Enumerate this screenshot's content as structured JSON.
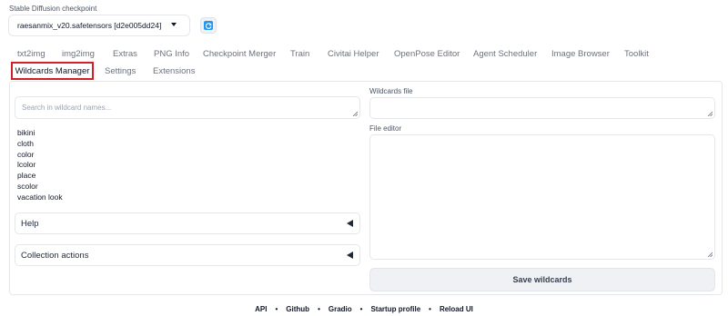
{
  "checkpoint": {
    "label": "Stable Diffusion checkpoint",
    "value": "raesanmix_v20.safetensors [d2e005dd24]"
  },
  "tabs": {
    "row1": [
      "txt2img",
      "img2img",
      "Extras",
      "PNG Info",
      "Checkpoint Merger",
      "Train",
      "Civitai Helper",
      "OpenPose Editor",
      "Agent Scheduler",
      "Image Browser",
      "Toolkit"
    ],
    "row2": [
      "Wildcards Manager",
      "Settings",
      "Extensions"
    ],
    "active": "Wildcards Manager"
  },
  "wildcards": {
    "search_placeholder": "Search in wildcard names...",
    "items": [
      "bikini",
      "cloth",
      "color",
      "lcolor",
      "place",
      "scolor",
      "vacation look"
    ],
    "help_label": "Help",
    "collection_label": "Collection actions",
    "file_label": "Wildcards file",
    "editor_label": "File editor",
    "save_label": "Save wildcards"
  },
  "footer": {
    "links": [
      "API",
      "Github",
      "Gradio",
      "Startup profile",
      "Reload UI"
    ]
  },
  "colors": {
    "active_tab_outline": "#d41f26",
    "refresh_accent": "#2196f3"
  }
}
